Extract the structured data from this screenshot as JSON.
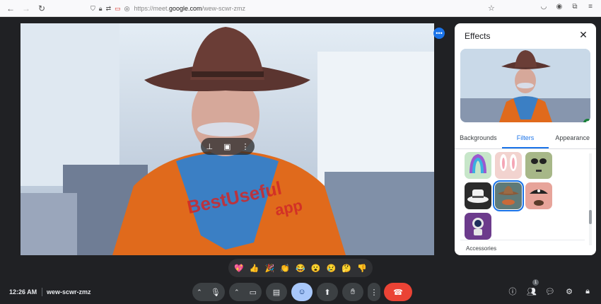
{
  "browser": {
    "url_prefix": "https://meet.",
    "url_domain": "google.com",
    "url_path": "/wew-scwr-zmz"
  },
  "video_watermark": "BestUseful",
  "video_watermark2": "app",
  "effects_panel": {
    "title": "Effects",
    "layer_count": "2",
    "tabs": [
      "Backgrounds",
      "Filters",
      "Appearance"
    ],
    "active_tab": "Filters",
    "section_label": "Accessories"
  },
  "reactions": [
    "💖",
    "👍",
    "🎉",
    "👏",
    "😂",
    "😮",
    "😢",
    "🤔",
    "👎"
  ],
  "meeting": {
    "time": "12:26 AM",
    "code": "wew-scwr-zmz",
    "people_count": "1"
  },
  "colors": {
    "accent": "#1a73e8",
    "end_call": "#ea4335",
    "active_control": "#a8c7fa"
  }
}
